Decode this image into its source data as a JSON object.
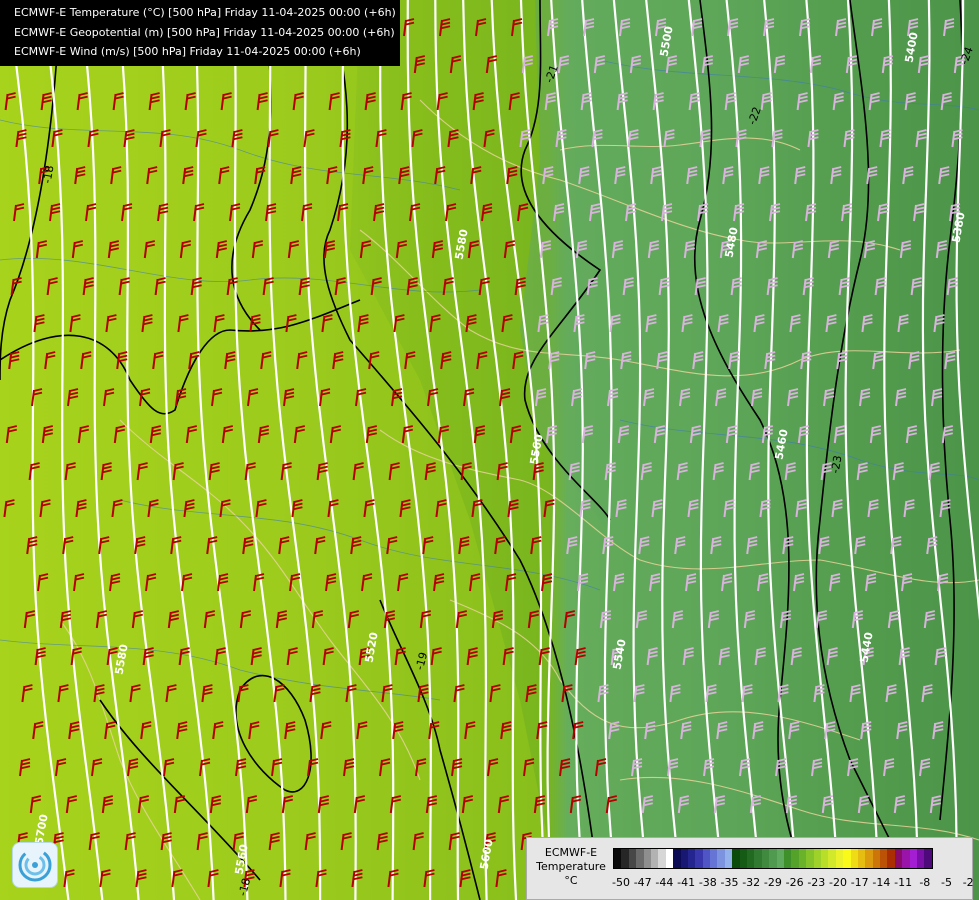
{
  "header": {
    "lines": [
      "ECMWF-E Temperature (°C) [500 hPa] Friday 11-04-2025 00:00 (+6h)",
      "ECMWF-E Geopotential (m) [500 hPa] Friday 11-04-2025 00:00 (+6h)",
      "ECMWF-E Wind (m/s) [500 hPa] Friday 11-04-2025 00:00 (+6h)"
    ]
  },
  "legend": {
    "model": "ECMWF-E",
    "variable": "Temperature",
    "unit": "°C",
    "tick_labels": [
      "-50",
      "-47",
      "-44",
      "-41",
      "-38",
      "-35",
      "-32",
      "-29",
      "-26",
      "-23",
      "-20",
      "-17",
      "-14",
      "-11",
      "-8",
      "-5",
      "-2"
    ],
    "colors": [
      "#0a0a0a",
      "#262626",
      "#474747",
      "#6b6b6b",
      "#8e8e8e",
      "#b2b2b2",
      "#d6d6d6",
      "#ffffff",
      "#0b0b55",
      "#181872",
      "#25258f",
      "#3838ac",
      "#4f55c4",
      "#6675d5",
      "#7c93e0",
      "#93b1ea",
      "#0a4a0a",
      "#155a15",
      "#226a22",
      "#317a31",
      "#408a40",
      "#509a50",
      "#60aa60",
      "#3f8f2a",
      "#54a22a",
      "#6ab22a",
      "#84c42a",
      "#9ed22a",
      "#b8de2a",
      "#d2e82a",
      "#ecf22a",
      "#fafa1a",
      "#f0dc16",
      "#e6be12",
      "#dc9a0e",
      "#cc760a",
      "#bb5206",
      "#aa2e02",
      "#8a0a6a",
      "#9a14aa",
      "#a41ed4",
      "#7a10a8",
      "#4e0a7a"
    ]
  },
  "map": {
    "geopotential_labels": [
      "5500",
      "5400",
      "5580",
      "5480",
      "5380",
      "5560",
      "5460",
      "5540",
      "5440",
      "5520",
      "5580",
      "5600",
      "5560",
      "5700"
    ],
    "temperature_labels": [
      "-21",
      "-22",
      "-24",
      "-18",
      "-23",
      "-19",
      "-18"
    ],
    "wind_barb_colors": {
      "warm": "#b40000",
      "cold": "#d8b4dc"
    },
    "field_colors": {
      "warm": "#9ccc1c",
      "mid": "#7fb82a",
      "cold_light": "#68b060",
      "cold_dark": "#3d8a3a"
    }
  }
}
